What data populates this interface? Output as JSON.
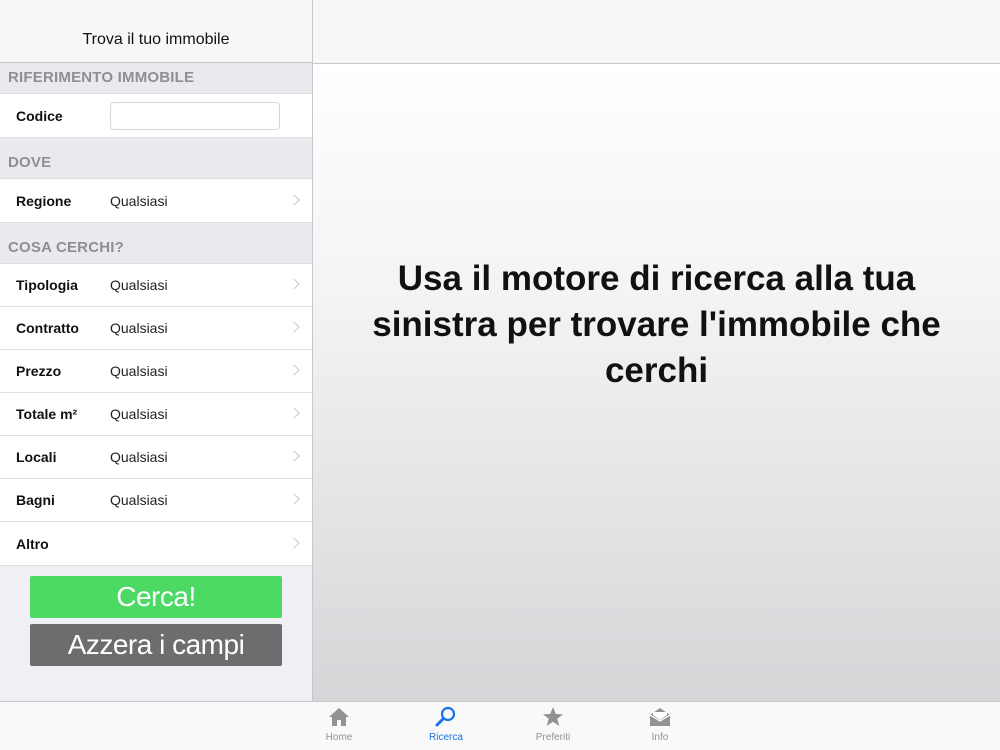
{
  "left_panel": {
    "title": "Trova il tuo immobile",
    "sections": {
      "riferimento": {
        "header": "RIFERIMENTO IMMOBILE",
        "codice_label": "Codice",
        "codice_value": "",
        "codice_placeholder": ""
      },
      "dove": {
        "header": "DOVE",
        "rows": [
          {
            "label": "Regione",
            "value": "Qualsiasi"
          }
        ]
      },
      "cosa": {
        "header": "COSA CERCHI?",
        "rows": [
          {
            "label": "Tipologia",
            "value": "Qualsiasi"
          },
          {
            "label": "Contratto",
            "value": "Qualsiasi"
          },
          {
            "label": "Prezzo",
            "value": "Qualsiasi"
          },
          {
            "label": "Totale m²",
            "value": "Qualsiasi"
          },
          {
            "label": "Locali",
            "value": "Qualsiasi"
          },
          {
            "label": "Bagni",
            "value": "Qualsiasi"
          },
          {
            "label": "Altro",
            "value": ""
          }
        ]
      }
    },
    "buttons": {
      "search": "Cerca!",
      "reset": "Azzera i campi"
    }
  },
  "main": {
    "message": "Usa il motore di ricerca alla tua sinistra per trovare l'immobile che cerchi"
  },
  "tabbar": {
    "tabs": [
      {
        "label": "Home",
        "icon": "home-icon"
      },
      {
        "label": "Ricerca",
        "icon": "search-icon",
        "active": true
      },
      {
        "label": "Preferiti",
        "icon": "star-icon"
      },
      {
        "label": "Info",
        "icon": "envelope-icon"
      }
    ]
  },
  "colors": {
    "search_button": "#4cd964",
    "reset_button": "#6d6d70",
    "active_tab": "#1a73e8",
    "inactive_tab": "#929292"
  }
}
